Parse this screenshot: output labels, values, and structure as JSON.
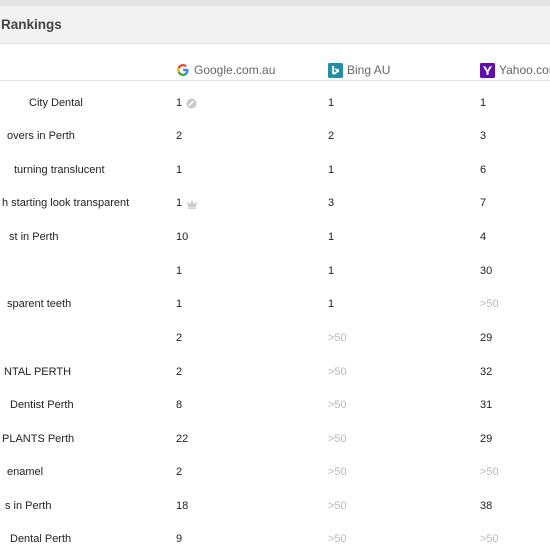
{
  "panel": {
    "title": "Rankings"
  },
  "columns": {
    "google": {
      "label": "Google.com.au",
      "icon": "google-icon"
    },
    "bing": {
      "label": "Bing AU",
      "icon": "bing-icon"
    },
    "yahoo": {
      "label": "Yahoo.com",
      "icon": "yahoo-icon"
    }
  },
  "colors": {
    "google_blue": "#4285f4",
    "bing_teal": "#258ea5",
    "yahoo_purple": "#5f0ea8",
    "muted_rank": "#b9b9b9"
  },
  "rows": [
    {
      "keyword": "City Dental",
      "google": "1",
      "google_badge": "featured-snippet-icon",
      "bing": "1",
      "yahoo": "1"
    },
    {
      "keyword": "overs in Perth",
      "google": "2",
      "bing": "2",
      "yahoo": "3"
    },
    {
      "keyword": "turning translucent",
      "google": "1",
      "bing": "1",
      "yahoo": "6"
    },
    {
      "keyword": "h starting look transparent",
      "google": "1",
      "google_badge": "crown-icon",
      "bing": "3",
      "yahoo": "7"
    },
    {
      "keyword": "st in Perth",
      "google": "10",
      "bing": "1",
      "yahoo": "4"
    },
    {
      "keyword": "",
      "google": "1",
      "bing": "1",
      "yahoo": "30"
    },
    {
      "keyword": "sparent teeth",
      "google": "1",
      "bing": "1",
      "yahoo": ">50"
    },
    {
      "keyword": "",
      "google": "2",
      "bing": ">50",
      "yahoo": "29"
    },
    {
      "keyword": "NTAL PERTH",
      "google": "2",
      "bing": ">50",
      "yahoo": "32"
    },
    {
      "keyword": "Dentist Perth",
      "google": "8",
      "bing": ">50",
      "yahoo": "31"
    },
    {
      "keyword": "PLANTS Perth",
      "google": "22",
      "bing": ">50",
      "yahoo": "29"
    },
    {
      "keyword": "enamel",
      "google": "2",
      "bing": ">50",
      "yahoo": ">50"
    },
    {
      "keyword": "s in Perth",
      "google": "18",
      "bing": ">50",
      "yahoo": "38"
    },
    {
      "keyword": "Dental Perth",
      "google": "9",
      "bing": ">50",
      "yahoo": ">50"
    }
  ]
}
